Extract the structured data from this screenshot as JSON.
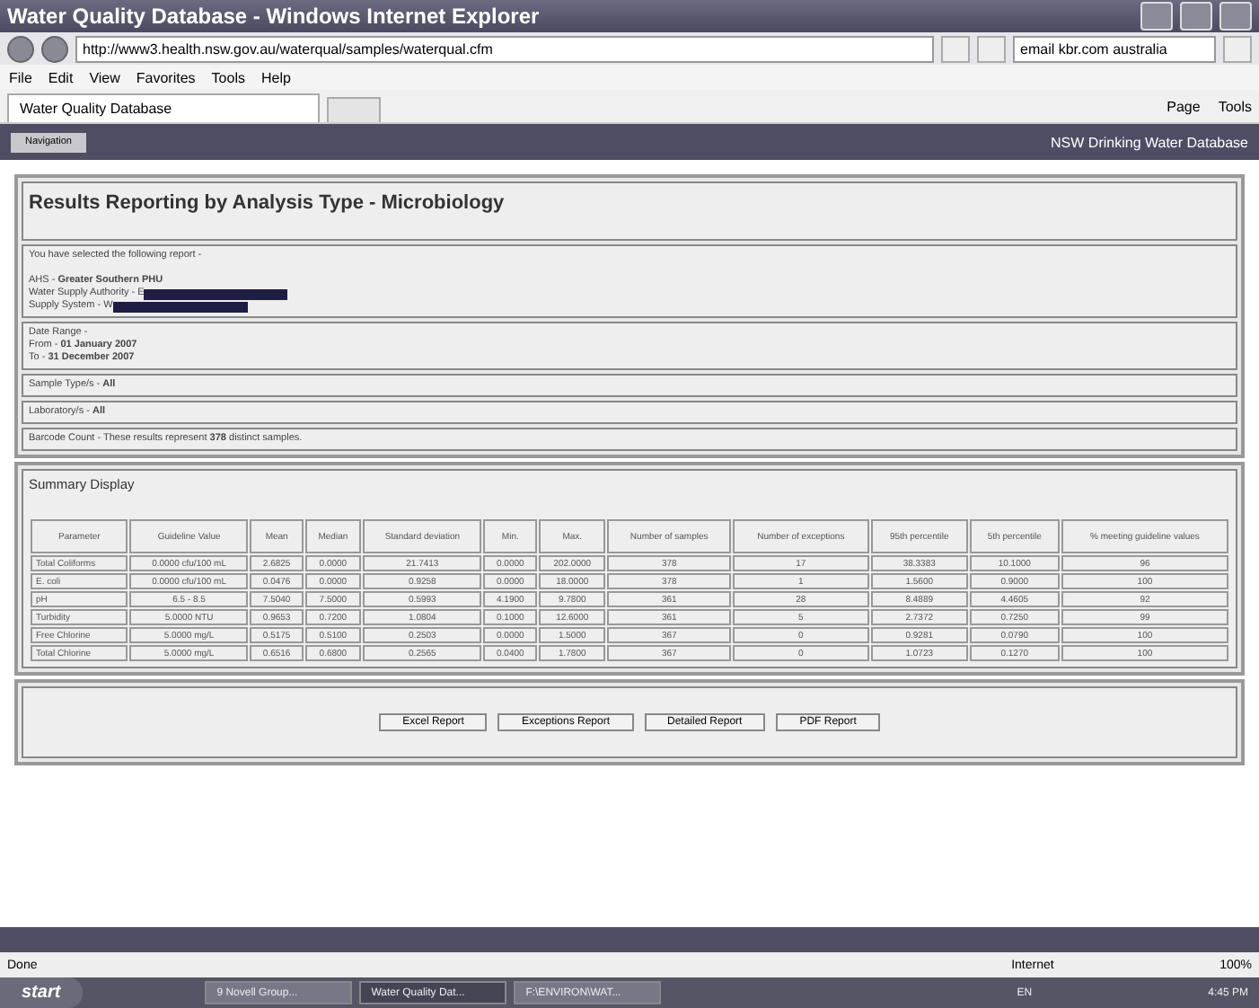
{
  "window": {
    "title": "Water Quality Database - Windows Internet Explorer"
  },
  "address_bar": {
    "url": "http://www3.health.nsw.gov.au/waterqual/samples/waterqual.cfm",
    "search": "email kbr.com australia"
  },
  "menu": [
    "File",
    "Edit",
    "View",
    "Favorites",
    "Tools",
    "Help"
  ],
  "tabs": [
    {
      "label": "Water Quality Database",
      "selected": true
    }
  ],
  "command_bar": [
    "Page",
    "Tools"
  ],
  "site_header": {
    "nav_button": "Navigation",
    "title": "NSW Drinking Water Database"
  },
  "report": {
    "heading": "Results Reporting by Analysis Type - Microbiology",
    "intro": "You have selected the following report -",
    "selection": [
      {
        "text": "AHS - **Greater Southern PHU**",
        "redacted": false
      },
      {
        "text": "Water Supply Authority - E",
        "redacted": true
      },
      {
        "text": "Supply System - W",
        "redacted": true
      }
    ],
    "date_range": [
      "Date Range -",
      "From - **01 January 2007**",
      "To - **31 December 2007**"
    ],
    "filters": [
      "Sample Type/s - **All**",
      "Laboratory/s - **All**",
      "Barcode Count - These results represent **378** distinct samples."
    ]
  },
  "summary": {
    "heading": "Summary Display",
    "columns": [
      "Parameter",
      "Guideline Value",
      "Mean",
      "Median",
      "Standard deviation",
      "Min.",
      "Max.",
      "Number of samples",
      "Number of exceptions",
      "95th percentile",
      "5th percentile",
      "% meeting guideline values"
    ],
    "rows": [
      [
        "Total Coliforms",
        "0.0000 cfu/100 mL",
        "2.6825",
        "0.0000",
        "21.7413",
        "0.0000",
        "202.0000",
        "378",
        "17",
        "38.3383",
        "10.1000",
        "96"
      ],
      [
        "E. coli",
        "0.0000 cfu/100 mL",
        "0.0476",
        "0.0000",
        "0.9258",
        "0.0000",
        "18.0000",
        "378",
        "1",
        "1.5600",
        "0.9000",
        "100"
      ],
      [
        "pH",
        "6.5 - 8.5",
        "7.5040",
        "7.5000",
        "0.5993",
        "4.1900",
        "9.7800",
        "361",
        "28",
        "8.4889",
        "4.4605",
        "92"
      ],
      [
        "Turbidity",
        "5.0000 NTU",
        "0.9653",
        "0.7200",
        "1.0804",
        "0.1000",
        "12.6000",
        "361",
        "5",
        "2.7372",
        "0.7250",
        "99"
      ],
      [
        "Free Chlorine",
        "5.0000 mg/L",
        "0.5175",
        "0.5100",
        "0.2503",
        "0.0000",
        "1.5000",
        "367",
        "0",
        "0.9281",
        "0.0790",
        "100"
      ],
      [
        "Total Chlorine",
        "5.0000 mg/L",
        "0.6516",
        "0.6800",
        "0.2565",
        "0.0400",
        "1.7800",
        "367",
        "0",
        "1.0723",
        "0.1270",
        "100"
      ]
    ]
  },
  "buttons": [
    "Excel Report",
    "Exceptions Report",
    "Detailed Report",
    "PDF Report"
  ],
  "status_bar": {
    "text": "Done",
    "zone": "Internet",
    "zoom": "100%"
  },
  "taskbar": {
    "start": "start",
    "items": [
      {
        "label": "9 Novell Group...",
        "selected": false
      },
      {
        "label": "Water Quality Dat...",
        "selected": true
      },
      {
        "label": "F:\\ENVIRON\\WAT...",
        "selected": false
      }
    ],
    "language": "EN",
    "clock": "4:45 PM"
  }
}
